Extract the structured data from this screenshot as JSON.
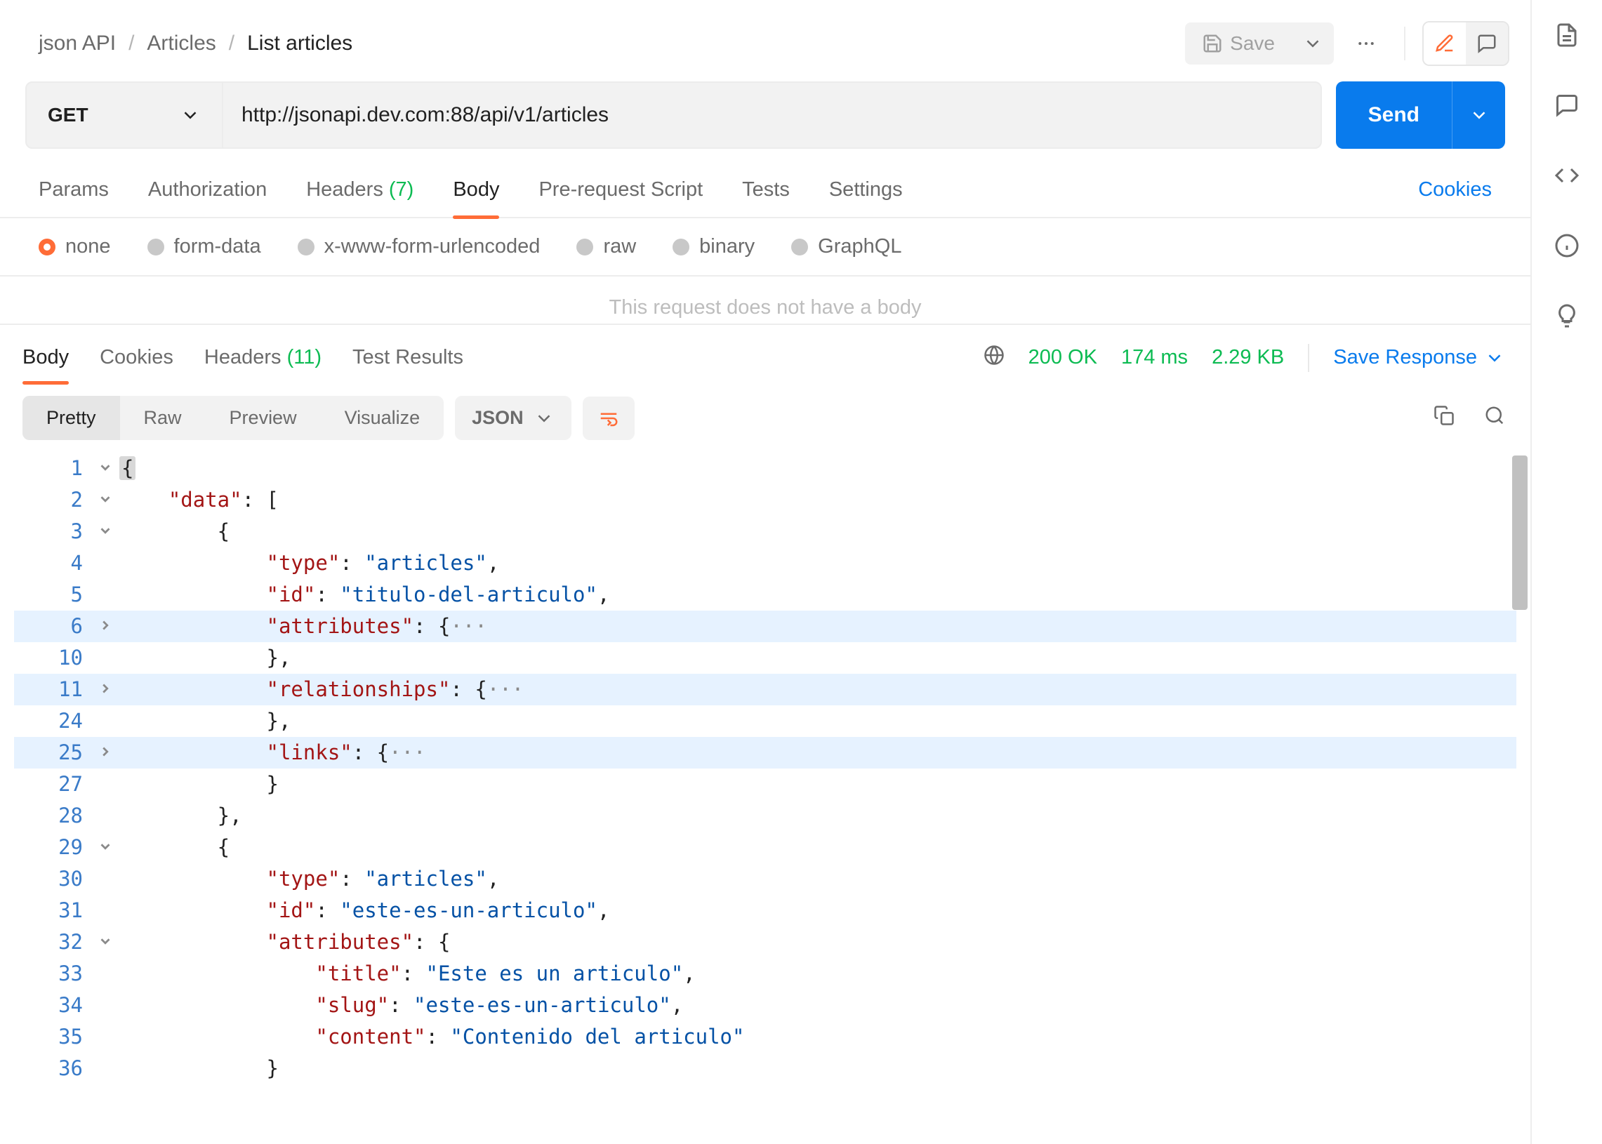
{
  "breadcrumb": {
    "root": "json API",
    "folder": "Articles",
    "current": "List articles"
  },
  "header": {
    "save_label": "Save"
  },
  "request": {
    "method": "GET",
    "url": "http://jsonapi.dev.com:88/api/v1/articles",
    "send_label": "Send"
  },
  "req_tabs": {
    "params": "Params",
    "authorization": "Authorization",
    "headers": "Headers",
    "headers_count": "(7)",
    "body": "Body",
    "prerequest": "Pre-request Script",
    "tests": "Tests",
    "settings": "Settings",
    "cookies": "Cookies"
  },
  "body_types": {
    "none": "none",
    "form_data": "form-data",
    "urlencoded": "x-www-form-urlencoded",
    "raw": "raw",
    "binary": "binary",
    "graphql": "GraphQL"
  },
  "no_body_msg": "This request does not have a body",
  "resp_tabs": {
    "body": "Body",
    "cookies": "Cookies",
    "headers": "Headers",
    "headers_count": "(11)",
    "test_results": "Test Results"
  },
  "resp_meta": {
    "status": "200 OK",
    "time": "174 ms",
    "size": "2.29 KB",
    "save_response": "Save Response"
  },
  "view": {
    "pretty": "Pretty",
    "raw": "Raw",
    "preview": "Preview",
    "visualize": "Visualize",
    "format": "JSON"
  },
  "code_lines": [
    {
      "num": "1",
      "fold": "down",
      "hl": false,
      "spans": [
        [
          "pun",
          "{"
        ]
      ]
    },
    {
      "num": "2",
      "fold": "down",
      "hl": false,
      "spans": [
        [
          "pun",
          "    "
        ],
        [
          "key",
          "\"data\""
        ],
        [
          "pun",
          ": ["
        ]
      ]
    },
    {
      "num": "3",
      "fold": "down",
      "hl": false,
      "spans": [
        [
          "pun",
          "        {"
        ]
      ]
    },
    {
      "num": "4",
      "fold": "",
      "hl": false,
      "spans": [
        [
          "pun",
          "            "
        ],
        [
          "key",
          "\"type\""
        ],
        [
          "pun",
          ": "
        ],
        [
          "str",
          "\"articles\""
        ],
        [
          "pun",
          ","
        ]
      ]
    },
    {
      "num": "5",
      "fold": "",
      "hl": false,
      "spans": [
        [
          "pun",
          "            "
        ],
        [
          "key",
          "\"id\""
        ],
        [
          "pun",
          ": "
        ],
        [
          "str",
          "\"titulo-del-articulo\""
        ],
        [
          "pun",
          ","
        ]
      ]
    },
    {
      "num": "6",
      "fold": "right",
      "hl": true,
      "spans": [
        [
          "pun",
          "            "
        ],
        [
          "key",
          "\"attributes\""
        ],
        [
          "pun",
          ": {"
        ],
        [
          "ell",
          "···"
        ]
      ]
    },
    {
      "num": "10",
      "fold": "",
      "hl": false,
      "spans": [
        [
          "pun",
          "            },"
        ]
      ]
    },
    {
      "num": "11",
      "fold": "right",
      "hl": true,
      "spans": [
        [
          "pun",
          "            "
        ],
        [
          "key",
          "\"relationships\""
        ],
        [
          "pun",
          ": {"
        ],
        [
          "ell",
          "···"
        ]
      ]
    },
    {
      "num": "24",
      "fold": "",
      "hl": false,
      "spans": [
        [
          "pun",
          "            },"
        ]
      ]
    },
    {
      "num": "25",
      "fold": "right",
      "hl": true,
      "spans": [
        [
          "pun",
          "            "
        ],
        [
          "key",
          "\"links\""
        ],
        [
          "pun",
          ": {"
        ],
        [
          "ell",
          "···"
        ]
      ]
    },
    {
      "num": "27",
      "fold": "",
      "hl": false,
      "spans": [
        [
          "pun",
          "            }"
        ]
      ]
    },
    {
      "num": "28",
      "fold": "",
      "hl": false,
      "spans": [
        [
          "pun",
          "        },"
        ]
      ]
    },
    {
      "num": "29",
      "fold": "down",
      "hl": false,
      "spans": [
        [
          "pun",
          "        {"
        ]
      ]
    },
    {
      "num": "30",
      "fold": "",
      "hl": false,
      "spans": [
        [
          "pun",
          "            "
        ],
        [
          "key",
          "\"type\""
        ],
        [
          "pun",
          ": "
        ],
        [
          "str",
          "\"articles\""
        ],
        [
          "pun",
          ","
        ]
      ]
    },
    {
      "num": "31",
      "fold": "",
      "hl": false,
      "spans": [
        [
          "pun",
          "            "
        ],
        [
          "key",
          "\"id\""
        ],
        [
          "pun",
          ": "
        ],
        [
          "str",
          "\"este-es-un-articulo\""
        ],
        [
          "pun",
          ","
        ]
      ]
    },
    {
      "num": "32",
      "fold": "down",
      "hl": false,
      "spans": [
        [
          "pun",
          "            "
        ],
        [
          "key",
          "\"attributes\""
        ],
        [
          "pun",
          ": {"
        ]
      ]
    },
    {
      "num": "33",
      "fold": "",
      "hl": false,
      "spans": [
        [
          "pun",
          "                "
        ],
        [
          "key",
          "\"title\""
        ],
        [
          "pun",
          ": "
        ],
        [
          "str",
          "\"Este es un articulo\""
        ],
        [
          "pun",
          ","
        ]
      ]
    },
    {
      "num": "34",
      "fold": "",
      "hl": false,
      "spans": [
        [
          "pun",
          "                "
        ],
        [
          "key",
          "\"slug\""
        ],
        [
          "pun",
          ": "
        ],
        [
          "str",
          "\"este-es-un-articulo\""
        ],
        [
          "pun",
          ","
        ]
      ]
    },
    {
      "num": "35",
      "fold": "",
      "hl": false,
      "spans": [
        [
          "pun",
          "                "
        ],
        [
          "key",
          "\"content\""
        ],
        [
          "pun",
          ": "
        ],
        [
          "str",
          "\"Contenido del articulo\""
        ]
      ]
    },
    {
      "num": "36",
      "fold": "",
      "hl": false,
      "spans": [
        [
          "pun",
          "            }"
        ]
      ]
    }
  ]
}
